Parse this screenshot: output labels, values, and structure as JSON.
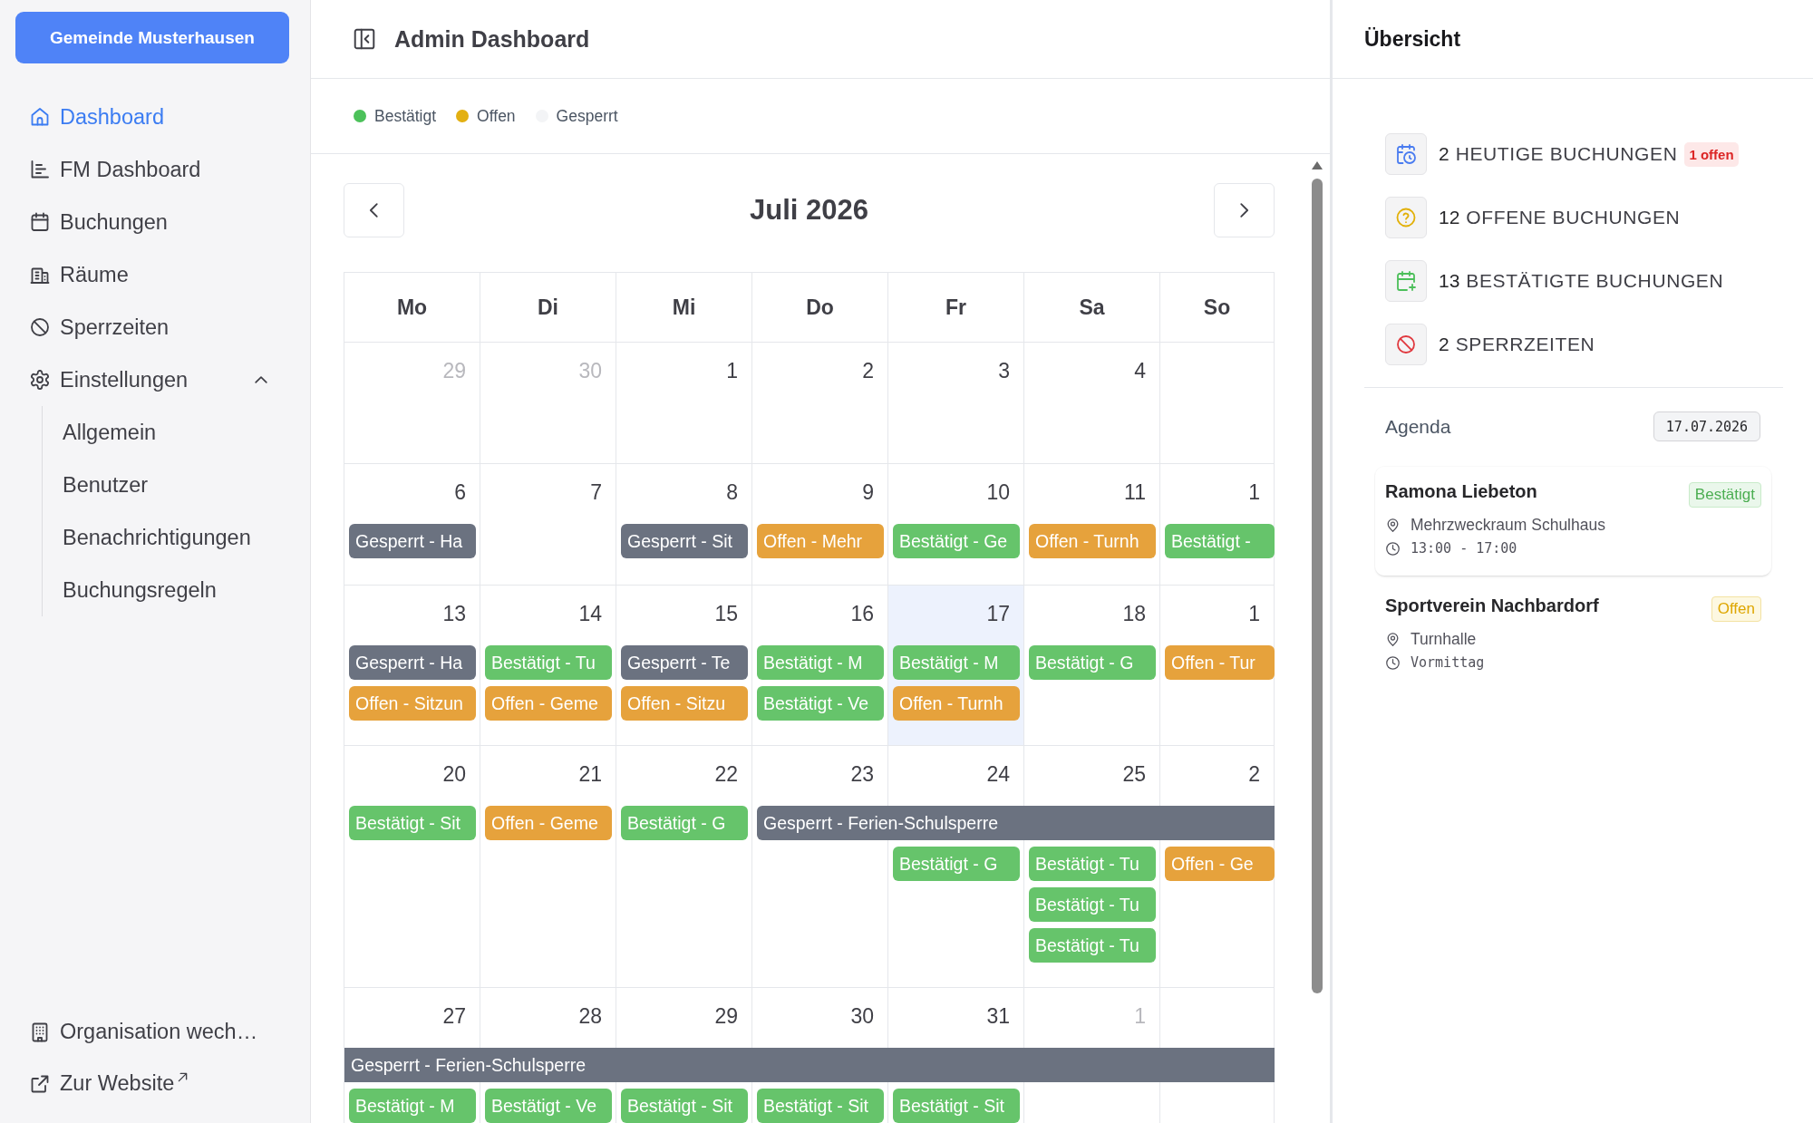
{
  "sidebar": {
    "brand": "Gemeinde Musterhausen",
    "items": [
      {
        "label": "Dashboard",
        "selected": true
      },
      {
        "label": "FM Dashboard",
        "selected": false
      },
      {
        "label": "Buchungen",
        "selected": false
      },
      {
        "label": "Räume",
        "selected": false
      },
      {
        "label": "Sperrzeiten",
        "selected": false
      },
      {
        "label": "Einstellungen",
        "selected": false,
        "expanded": true,
        "children": [
          {
            "label": "Allgemein",
            "selected": false
          },
          {
            "label": "Benutzer",
            "selected": false
          },
          {
            "label": "Benachrichtigungen",
            "selected": false
          },
          {
            "label": "Buchungsregeln",
            "selected": false
          }
        ]
      }
    ],
    "footer": [
      {
        "label": "Organisation wech…",
        "external": false
      },
      {
        "label": "Zur Website",
        "external": true
      }
    ]
  },
  "main": {
    "title": "Admin Dashboard",
    "legend": [
      {
        "label": "Bestätigt",
        "color": "#4cc15a"
      },
      {
        "label": "Offen",
        "color": "#e3b012"
      },
      {
        "label": "Gesperrt",
        "color": "#f3f4f6"
      }
    ],
    "calendar": {
      "month": "Juli 2026",
      "weekdays": [
        "Mo",
        "Di",
        "Mi",
        "Do",
        "Fr",
        "Sa",
        "So"
      ],
      "weeks": [
        {
          "days": [
            {
              "day": "29",
              "other_month": true,
              "today": false
            },
            {
              "day": "30",
              "other_month": true,
              "today": false
            },
            {
              "day": "1",
              "other_month": false,
              "today": false
            },
            {
              "day": "2",
              "other_month": false,
              "today": false
            },
            {
              "day": "3",
              "other_month": false,
              "today": false
            },
            {
              "day": "4",
              "other_month": false,
              "today": false
            },
            {
              "today": false
            }
          ]
        },
        {
          "days": [
            {
              "day": "6",
              "other_month": false,
              "today": false,
              "events": [
                {
                  "text": "Gesperrt - Ha",
                  "kind": "blocked",
                  "continues": false,
                  "carried_over": false
                }
              ]
            },
            {
              "day": "7",
              "other_month": false,
              "today": false
            },
            {
              "day": "8",
              "other_month": false,
              "today": false,
              "events": [
                {
                  "text": "Gesperrt - Sit",
                  "kind": "blocked",
                  "continues": false,
                  "carried_over": false
                }
              ]
            },
            {
              "day": "9",
              "other_month": false,
              "today": false,
              "events": [
                {
                  "text": "Offen - Mehr",
                  "kind": "open",
                  "continues": false,
                  "carried_over": false
                }
              ]
            },
            {
              "day": "10",
              "other_month": false,
              "today": false,
              "events": [
                {
                  "text": "Bestätigt - Ge",
                  "kind": "confirmed",
                  "continues": false,
                  "carried_over": false
                }
              ]
            },
            {
              "day": "11",
              "other_month": false,
              "today": false,
              "events": [
                {
                  "text": "Offen - Turnh",
                  "kind": "open",
                  "continues": false,
                  "carried_over": false
                }
              ]
            },
            {
              "day": "1",
              "other_month": false,
              "today": false,
              "events": [
                {
                  "text": "Bestätigt -",
                  "kind": "confirmed",
                  "continues": false,
                  "carried_over": false
                }
              ]
            }
          ]
        },
        {
          "days": [
            {
              "day": "13",
              "other_month": false,
              "today": false,
              "events": [
                {
                  "text": "Gesperrt - Ha",
                  "kind": "blocked",
                  "continues": false,
                  "carried_over": false
                },
                {
                  "text": "Offen - Sitzun",
                  "kind": "open",
                  "continues": false,
                  "carried_over": false
                }
              ]
            },
            {
              "day": "14",
              "other_month": false,
              "today": false,
              "events": [
                {
                  "text": "Bestätigt - Tu",
                  "kind": "confirmed",
                  "continues": false,
                  "carried_over": false
                },
                {
                  "text": "Offen - Geme",
                  "kind": "open",
                  "continues": false,
                  "carried_over": false
                }
              ]
            },
            {
              "day": "15",
              "other_month": false,
              "today": false,
              "events": [
                {
                  "text": "Gesperrt - Te",
                  "kind": "blocked",
                  "continues": false,
                  "carried_over": false
                },
                {
                  "text": "Offen - Sitzu",
                  "kind": "open",
                  "continues": false,
                  "carried_over": false
                }
              ]
            },
            {
              "day": "16",
              "other_month": false,
              "today": false,
              "events": [
                {
                  "text": "Bestätigt - M",
                  "kind": "confirmed",
                  "continues": false,
                  "carried_over": false
                },
                {
                  "text": "Bestätigt - Ve",
                  "kind": "confirmed",
                  "continues": false,
                  "carried_over": false
                }
              ]
            },
            {
              "day": "17",
              "other_month": false,
              "today": true,
              "events": [
                {
                  "text": "Bestätigt - M",
                  "kind": "confirmed",
                  "continues": false,
                  "carried_over": false
                },
                {
                  "text": "Offen - Turnh",
                  "kind": "open",
                  "continues": false,
                  "carried_over": false
                }
              ]
            },
            {
              "day": "18",
              "other_month": false,
              "today": false,
              "events": [
                {
                  "text": "Bestätigt - G",
                  "kind": "confirmed",
                  "continues": false,
                  "carried_over": false
                }
              ]
            },
            {
              "day": "1",
              "other_month": false,
              "today": false,
              "events": [
                {
                  "text": "Offen - Tur",
                  "kind": "open",
                  "continues": false,
                  "carried_over": false
                }
              ]
            }
          ]
        },
        {
          "days": [
            {
              "day": "20",
              "other_month": false,
              "today": false,
              "events": [
                {
                  "text": "Bestätigt - Sit",
                  "kind": "confirmed",
                  "continues": false,
                  "carried_over": false
                }
              ]
            },
            {
              "day": "21",
              "other_month": false,
              "today": false,
              "events": [
                {
                  "text": "Offen - Geme",
                  "kind": "open",
                  "continues": false,
                  "carried_over": false
                }
              ]
            },
            {
              "day": "22",
              "other_month": false,
              "today": false,
              "events": [
                {
                  "text": "Bestätigt - G",
                  "kind": "confirmed",
                  "continues": false,
                  "carried_over": false
                }
              ]
            },
            {
              "day": "23",
              "other_month": false,
              "today": false,
              "events": [
                {
                  "text": "Gesperrt - Ferien-Schulsperre",
                  "kind": "blocked",
                  "continues": true,
                  "carried_over": false
                }
              ]
            },
            {
              "day": "24",
              "other_month": false,
              "today": false,
              "events": [
                {
                  "text": "Bestätigt - G",
                  "kind": "confirmed",
                  "continues": false,
                  "carried_over": false
                }
              ]
            },
            {
              "day": "25",
              "other_month": false,
              "today": false,
              "events": [
                {
                  "text": "Bestätigt - Tu",
                  "kind": "confirmed",
                  "continues": false,
                  "carried_over": false
                },
                {
                  "text": "Bestätigt - Tu",
                  "kind": "confirmed",
                  "continues": false,
                  "carried_over": false
                },
                {
                  "text": "Bestätigt - Tu",
                  "kind": "confirmed",
                  "continues": false,
                  "carried_over": false
                }
              ]
            },
            {
              "day": "2",
              "other_month": false,
              "today": false,
              "events": [
                {
                  "text": "Offen - Ge",
                  "kind": "open",
                  "continues": false,
                  "carried_over": false
                }
              ]
            }
          ]
        },
        {
          "days": [
            {
              "day": "27",
              "other_month": false,
              "today": false,
              "events": [
                {
                  "text": "Gesperrt - Ferien-Schulsperre",
                  "kind": "blocked",
                  "continues": true,
                  "carried_over": true
                },
                {
                  "text": "Bestätigt - M",
                  "kind": "confirmed",
                  "continues": false,
                  "carried_over": false
                }
              ]
            },
            {
              "day": "28",
              "other_month": false,
              "today": false,
              "events": [
                {
                  "text": "Bestätigt - Ve",
                  "kind": "confirmed",
                  "continues": false,
                  "carried_over": false
                }
              ]
            },
            {
              "day": "29",
              "other_month": false,
              "today": false,
              "events": [
                {
                  "text": "Bestätigt - Sit",
                  "kind": "confirmed",
                  "continues": false,
                  "carried_over": false
                }
              ]
            },
            {
              "day": "30",
              "other_month": false,
              "today": false,
              "events": [
                {
                  "text": "Bestätigt - Sit",
                  "kind": "confirmed",
                  "continues": false,
                  "carried_over": false
                }
              ]
            },
            {
              "day": "31",
              "other_month": false,
              "today": false,
              "events": [
                {
                  "text": "Bestätigt - Sit",
                  "kind": "confirmed",
                  "continues": false,
                  "carried_over": false
                }
              ]
            },
            {
              "day": "1",
              "other_month": true,
              "today": false
            },
            {
              "today": false
            }
          ]
        }
      ]
    }
  },
  "overview": {
    "title": "Übersicht",
    "stats": [
      {
        "kind": "today",
        "count": "2",
        "label": "HEUTIGE BUCHUNGEN",
        "badge": "1 offen"
      },
      {
        "kind": "open",
        "count": "12",
        "label": "OFFENE BUCHUNGEN"
      },
      {
        "kind": "confirmed",
        "count": "13",
        "label": "BESTÄTIGTE BUCHUNGEN"
      },
      {
        "kind": "blocked",
        "count": "2",
        "label": "SPERRZEITEN"
      }
    ],
    "agenda": {
      "title": "Agenda",
      "date": "17.07.2026",
      "items": [
        {
          "name": "Ramona Liebeton",
          "status": "Bestätigt",
          "kind": "confirmed",
          "location": "Mehrzweckraum Schulhaus",
          "time": "13:00 - 17:00",
          "selected": true
        },
        {
          "name": "Sportverein Nachbardorf",
          "status": "Offen",
          "kind": "open",
          "location": "Turnhalle",
          "time": "Vormittag",
          "selected": false
        }
      ]
    }
  }
}
